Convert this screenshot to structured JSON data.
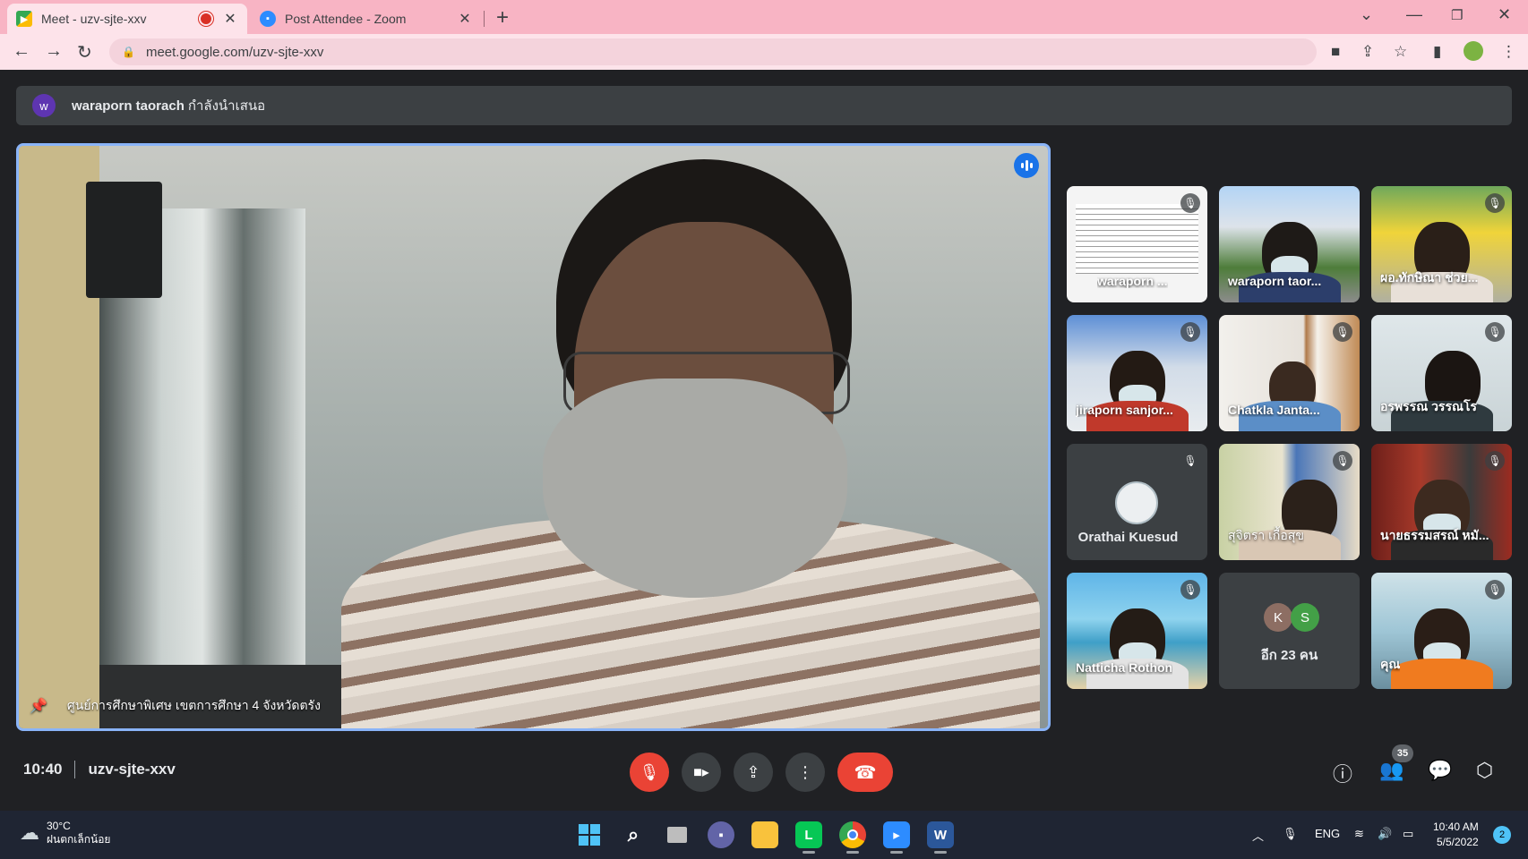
{
  "browser": {
    "tabs": [
      {
        "title": "Meet - uzv-sjte-xxv",
        "active": true,
        "recording": true
      },
      {
        "title": "Post Attendee - Zoom",
        "active": false
      }
    ],
    "url": "meet.google.com/uzv-sjte-xxv"
  },
  "banner": {
    "avatar_initial": "w",
    "presenter_name": "waraporn taorach",
    "presenting_text": "กำลังนำเสนอ"
  },
  "main_video": {
    "pinned_label": "ศูนย์การศึกษาพิเศษ เขตการศึกษา 4 จังหวัดตรัง"
  },
  "participants": [
    {
      "name": "waraporn ...",
      "muted": true
    },
    {
      "name": "waraporn taor...",
      "muted": false
    },
    {
      "name": "ผอ.ทักษิณา ช่วย...",
      "muted": true
    },
    {
      "name": "jiraporn sanjor...",
      "muted": true
    },
    {
      "name": "Chatkla Janta...",
      "muted": true
    },
    {
      "name": "อรพรรณ วรรณโร",
      "muted": true
    },
    {
      "name": "Orathai Kuesud",
      "muted": true
    },
    {
      "name": "สุจิตรา เกื้อสุข",
      "muted": true
    },
    {
      "name": "นายธรรมสรณ์ หมั...",
      "muted": true
    },
    {
      "name": "Natticha Rothon",
      "muted": true
    },
    {
      "name": "อีก 23 คน",
      "more_initials": [
        "K",
        "S"
      ]
    },
    {
      "name": "คุณ",
      "muted": true
    }
  ],
  "bottom_bar": {
    "time": "10:40",
    "meeting_code": "uzv-sjte-xxv",
    "participant_count": "35"
  },
  "taskbar": {
    "weather_temp": "30°C",
    "weather_desc": "ฝนตกเล็กน้อย",
    "language": "ENG",
    "clock_time": "10:40 AM",
    "clock_date": "5/5/2022",
    "notification_count": "2"
  },
  "colors": {
    "accent_blue": "#8ab4f8",
    "danger_red": "#ea4335",
    "meet_bg": "#202124",
    "tab_strip": "#f8b4c4"
  }
}
